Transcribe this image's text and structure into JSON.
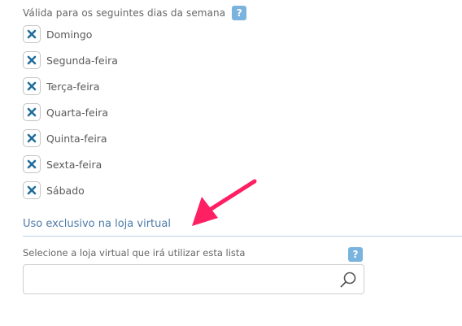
{
  "days_section": {
    "label": "Válida para os seguintes dias da semana",
    "help": "?",
    "days": [
      {
        "label": "Domingo",
        "checked": true
      },
      {
        "label": "Segunda-feira",
        "checked": true
      },
      {
        "label": "Terça-feira",
        "checked": true
      },
      {
        "label": "Quarta-feira",
        "checked": true
      },
      {
        "label": "Quinta-feira",
        "checked": true
      },
      {
        "label": "Sexta-feira",
        "checked": true
      },
      {
        "label": "Sábado",
        "checked": true
      }
    ]
  },
  "store_section": {
    "title": "Uso exclusivo na loja virtual",
    "label": "Selecione a loja virtual que irá utilizar esta lista",
    "help": "?",
    "search_value": "",
    "search_icon": "search-icon"
  },
  "colors": {
    "check_mark": "#1f6e9c",
    "help_bg": "#7ab4de",
    "section_title": "#4d7aa9",
    "annotation_arrow": "#ff1f63"
  }
}
